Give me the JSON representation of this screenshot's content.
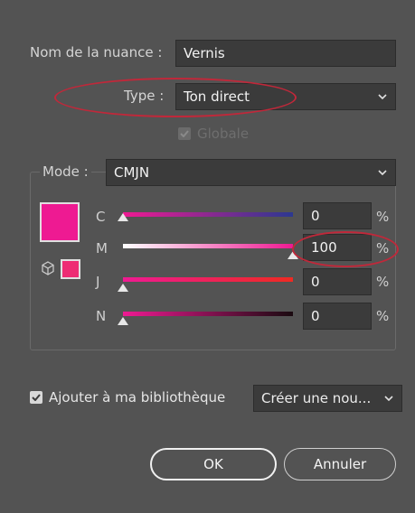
{
  "swatch_name": {
    "label": "Nom de la nuance :",
    "value": "Vernis"
  },
  "type": {
    "label": "Type :",
    "value": "Ton direct",
    "icon": "chevron-down-icon"
  },
  "global": {
    "label": "Globale",
    "checked": true,
    "disabled": true
  },
  "mode": {
    "label": "Mode :",
    "value": "CMJN",
    "icon": "chevron-down-icon"
  },
  "preview": {
    "color": "#ee1a92",
    "small_color": "#ee2c74",
    "gamut_icon": "cube-icon"
  },
  "channels": [
    {
      "label": "C",
      "value": "0",
      "unit": "%",
      "level": 0
    },
    {
      "label": "M",
      "value": "100",
      "unit": "%",
      "level": 100
    },
    {
      "label": "J",
      "value": "0",
      "unit": "%",
      "level": 0
    },
    {
      "label": "N",
      "value": "0",
      "unit": "%",
      "level": 0
    }
  ],
  "library": {
    "label": "Ajouter à ma bibliothèque",
    "checked": true,
    "dropdown_value": "Créer une nou...",
    "icon": "chevron-down-icon"
  },
  "buttons": {
    "ok": "OK",
    "cancel": "Annuler"
  },
  "colors": {
    "background": "#535353",
    "field": "#3b3b3b",
    "annotation": "#c0283a",
    "accent": "#ee1a92"
  }
}
